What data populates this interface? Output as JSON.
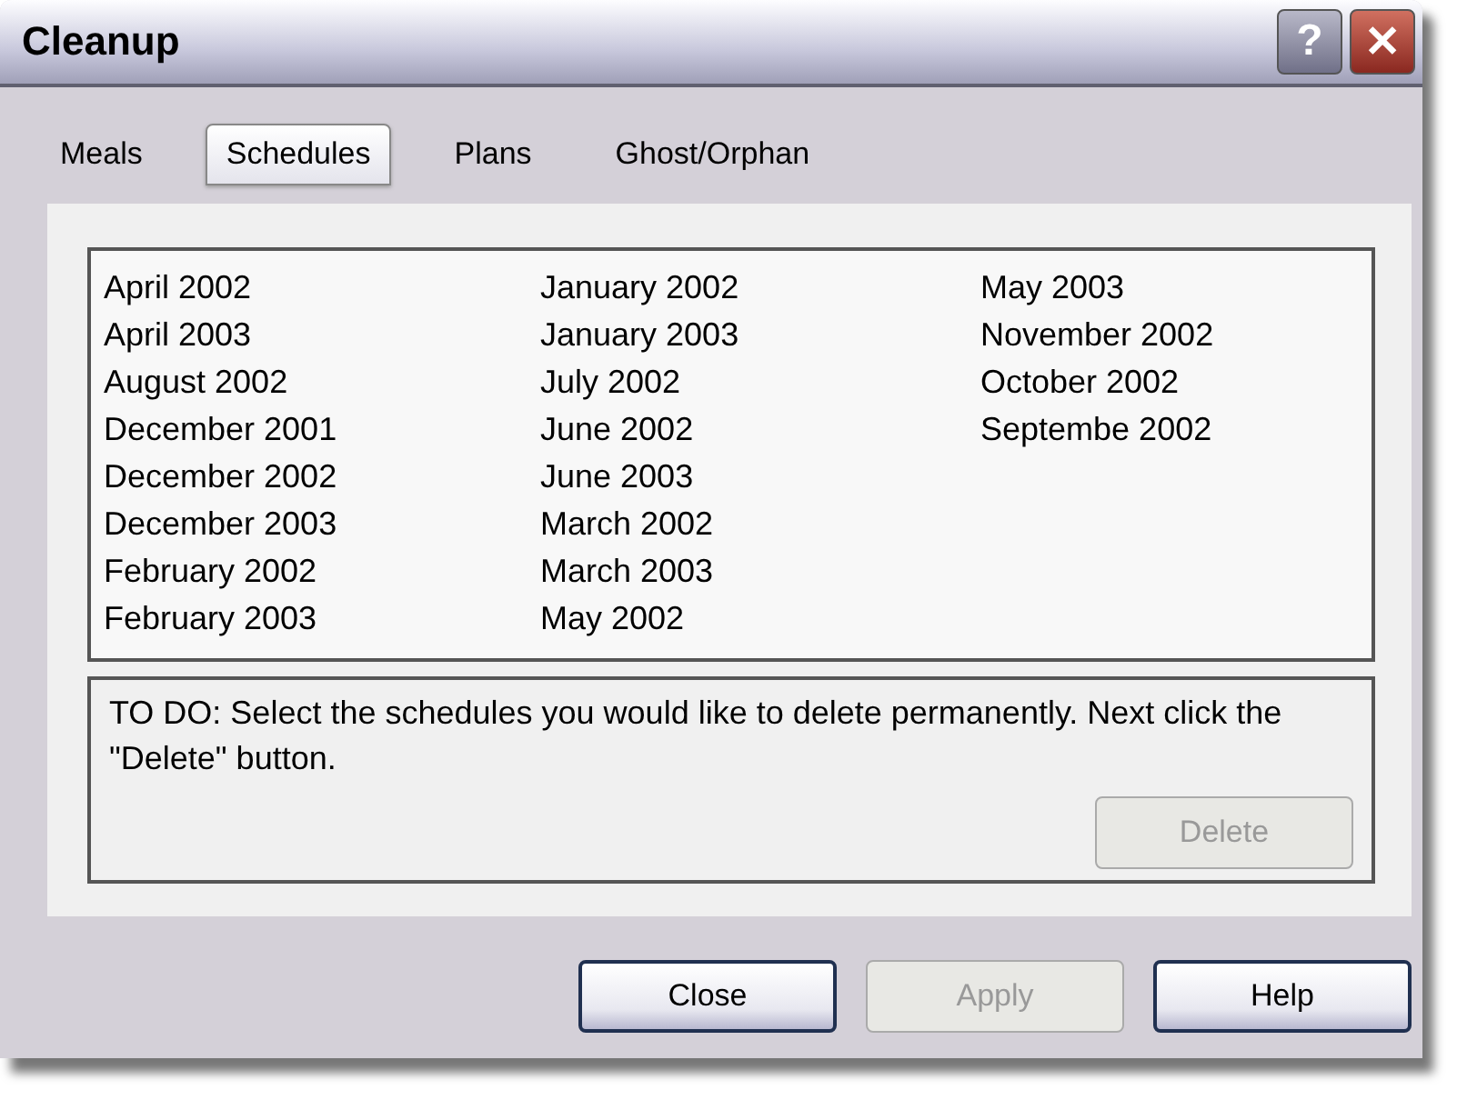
{
  "window": {
    "title": "Cleanup",
    "help_button": "?",
    "close_button": "✕"
  },
  "tabs": [
    {
      "label": "Meals",
      "selected": false
    },
    {
      "label": "Schedules",
      "selected": true
    },
    {
      "label": "Plans",
      "selected": false
    },
    {
      "label": "Ghost/Orphan",
      "selected": false
    }
  ],
  "schedules": [
    {
      "label": "April 2002",
      "selected": false
    },
    {
      "label": "April 2003",
      "selected": false
    },
    {
      "label": "August 2002",
      "selected": false
    },
    {
      "label": "December 2001",
      "selected": false
    },
    {
      "label": "December 2002",
      "selected": false
    },
    {
      "label": "December 2003",
      "selected": false
    },
    {
      "label": "February 2002",
      "selected": false
    },
    {
      "label": "February 2003",
      "selected": false
    },
    {
      "label": "January 2002",
      "selected": false
    },
    {
      "label": "January 2003",
      "selected": false
    },
    {
      "label": "July 2002",
      "selected": false
    },
    {
      "label": "June 2002",
      "selected": false
    },
    {
      "label": "June 2003",
      "selected": false
    },
    {
      "label": "March 2002",
      "selected": false
    },
    {
      "label": "March 2003",
      "selected": false
    },
    {
      "label": "May 2002",
      "selected": false
    },
    {
      "label": "May 2003",
      "selected": false
    },
    {
      "label": "November 2002",
      "selected": false
    },
    {
      "label": "October 2002",
      "selected": false
    },
    {
      "label": "Septembe 2002",
      "selected": false
    }
  ],
  "instructions": "TO DO: Select the schedules you would like to delete permanently. Next click the \"Delete\" button.",
  "delete_button": {
    "label": "Delete",
    "disabled": true
  },
  "buttons": [
    {
      "label": "Close",
      "disabled": false
    },
    {
      "label": "Apply",
      "disabled": true
    },
    {
      "label": "Help",
      "disabled": false
    }
  ]
}
